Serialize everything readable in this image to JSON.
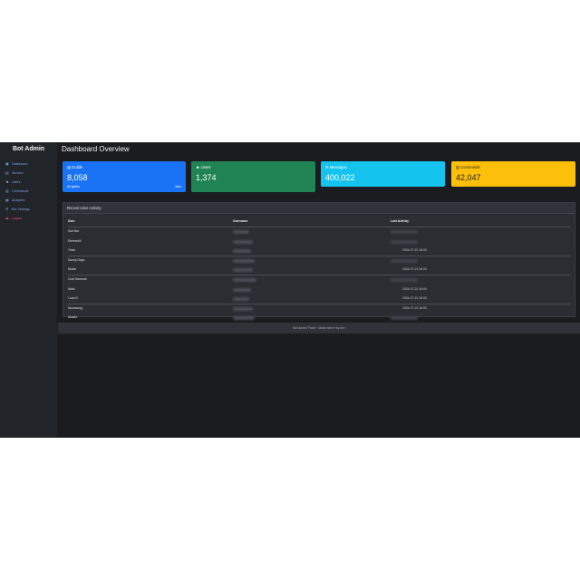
{
  "brand": {
    "title": "Bot Admin"
  },
  "sidebar": {
    "items": [
      {
        "icon": "gauge-icon",
        "glyph": "▣",
        "label": "Dashboard"
      },
      {
        "icon": "server-icon",
        "glyph": "▤",
        "label": "Servers"
      },
      {
        "icon": "users-icon",
        "glyph": "☻",
        "label": "Users"
      },
      {
        "icon": "terminal-icon",
        "glyph": "▥",
        "label": "Commands"
      },
      {
        "icon": "chart-icon",
        "glyph": "▦",
        "label": "Analytics"
      },
      {
        "icon": "gear-icon",
        "glyph": "⚙",
        "label": "Bot Settings"
      }
    ],
    "logout": {
      "icon": "logout-icon",
      "glyph": "⏏",
      "label": "Logout"
    }
  },
  "page": {
    "title": "Dashboard Overview"
  },
  "cards": [
    {
      "label": "Guilds",
      "value": "8,058",
      "sub": "All guilds",
      "link": "View",
      "color": "#1a72f5",
      "icon": "server-icon"
    },
    {
      "label": "Users",
      "value": "1,374",
      "sub": "",
      "link": "",
      "color": "#1f8354",
      "icon": "users-icon"
    },
    {
      "label": "Messages",
      "value": "400,022",
      "sub": "",
      "link": "",
      "color": "#14c4ee",
      "icon": "message-icon"
    },
    {
      "label": "Commands",
      "value": "42,047",
      "sub": "",
      "link": "",
      "color": "#fcc00b",
      "icon": "terminal-icon"
    }
  ],
  "activity": {
    "title": "Recent User Activity",
    "headers": [
      "User",
      "Username",
      "Last Activity"
    ],
    "rows": [
      {
        "user": "Sub Bot",
        "time": ""
      },
      {
        "user": "ElementX",
        "time": ""
      },
      {
        "user": "Trixie",
        "time": "2024-07-21 16:00"
      },
      {
        "user": "Sunny Days",
        "time": ""
      },
      {
        "user": "Rukia",
        "time": "2024-07-21 16:00"
      },
      {
        "user": "Cool Samurai",
        "time": ""
      },
      {
        "user": "Mirai",
        "time": "2024-07-21 16:00"
      },
      {
        "user": "Luna D",
        "time": "2024-07-21 16:00"
      },
      {
        "user": "Moonsong",
        "time": "2024-07-21 16:00"
      },
      {
        "user": "Akashi",
        "time": ""
      }
    ]
  },
  "footer": {
    "text": "Bot Admin Panel · Made with ♥ by dev"
  },
  "colors": {
    "background": "#1a1c1f",
    "sidebar": "#212428",
    "panel": "#2a2d31"
  }
}
